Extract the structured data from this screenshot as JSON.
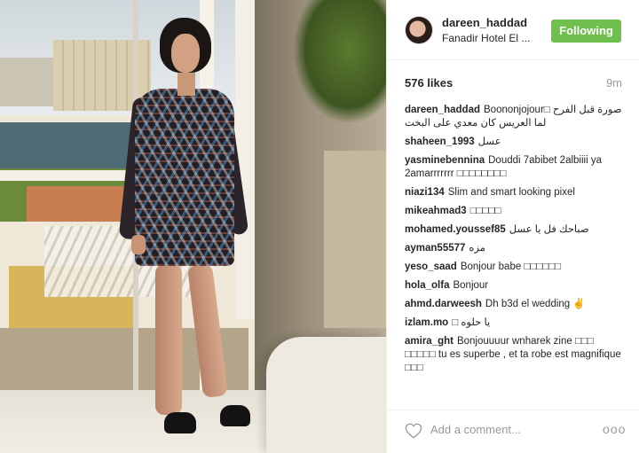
{
  "post": {
    "username": "dareen_haddad",
    "location": "Fanadir Hotel El ...",
    "follow_label": "Following",
    "likes": "576 likes",
    "time": "9m",
    "colors": {
      "following_button": "#70c050"
    }
  },
  "comments": [
    {
      "user": "dareen_haddad",
      "text": "Boononjojour□ صورة قبل الفرح لما العريس كان معدي على البخت"
    },
    {
      "user": "shaheen_1993",
      "text": "عسل"
    },
    {
      "user": "yasminebennina",
      "text": "Douddi 7abibet 2albiiii ya 2amarrrrrrr □□□□□□□□"
    },
    {
      "user": "niazi134",
      "text": "Slim and smart looking pixel"
    },
    {
      "user": "mikeahmad3",
      "text": "□□□□□"
    },
    {
      "user": "mohamed.youssef85",
      "text": "صباحك فل يا عسل"
    },
    {
      "user": "ayman55577",
      "text": "مزه"
    },
    {
      "user": "yeso_saad",
      "text": "Bonjour babe □□□□□□"
    },
    {
      "user": "hola_olfa",
      "text": "Bonjour"
    },
    {
      "user": "ahmd.darweesh",
      "text": "Dh b3d el wedding ✌"
    },
    {
      "user": "izlam.mo",
      "text": "□ يا حلوه"
    },
    {
      "user": "amira_ght",
      "text": "Bonjouuuur wnharek zine □□□ □□□□□ tu es superbe , et ta robe est magnifique □□□"
    }
  ],
  "footer": {
    "add_comment_placeholder": "Add a comment...",
    "more_label": "ooo",
    "heart_icon": "heart-outline-icon"
  }
}
